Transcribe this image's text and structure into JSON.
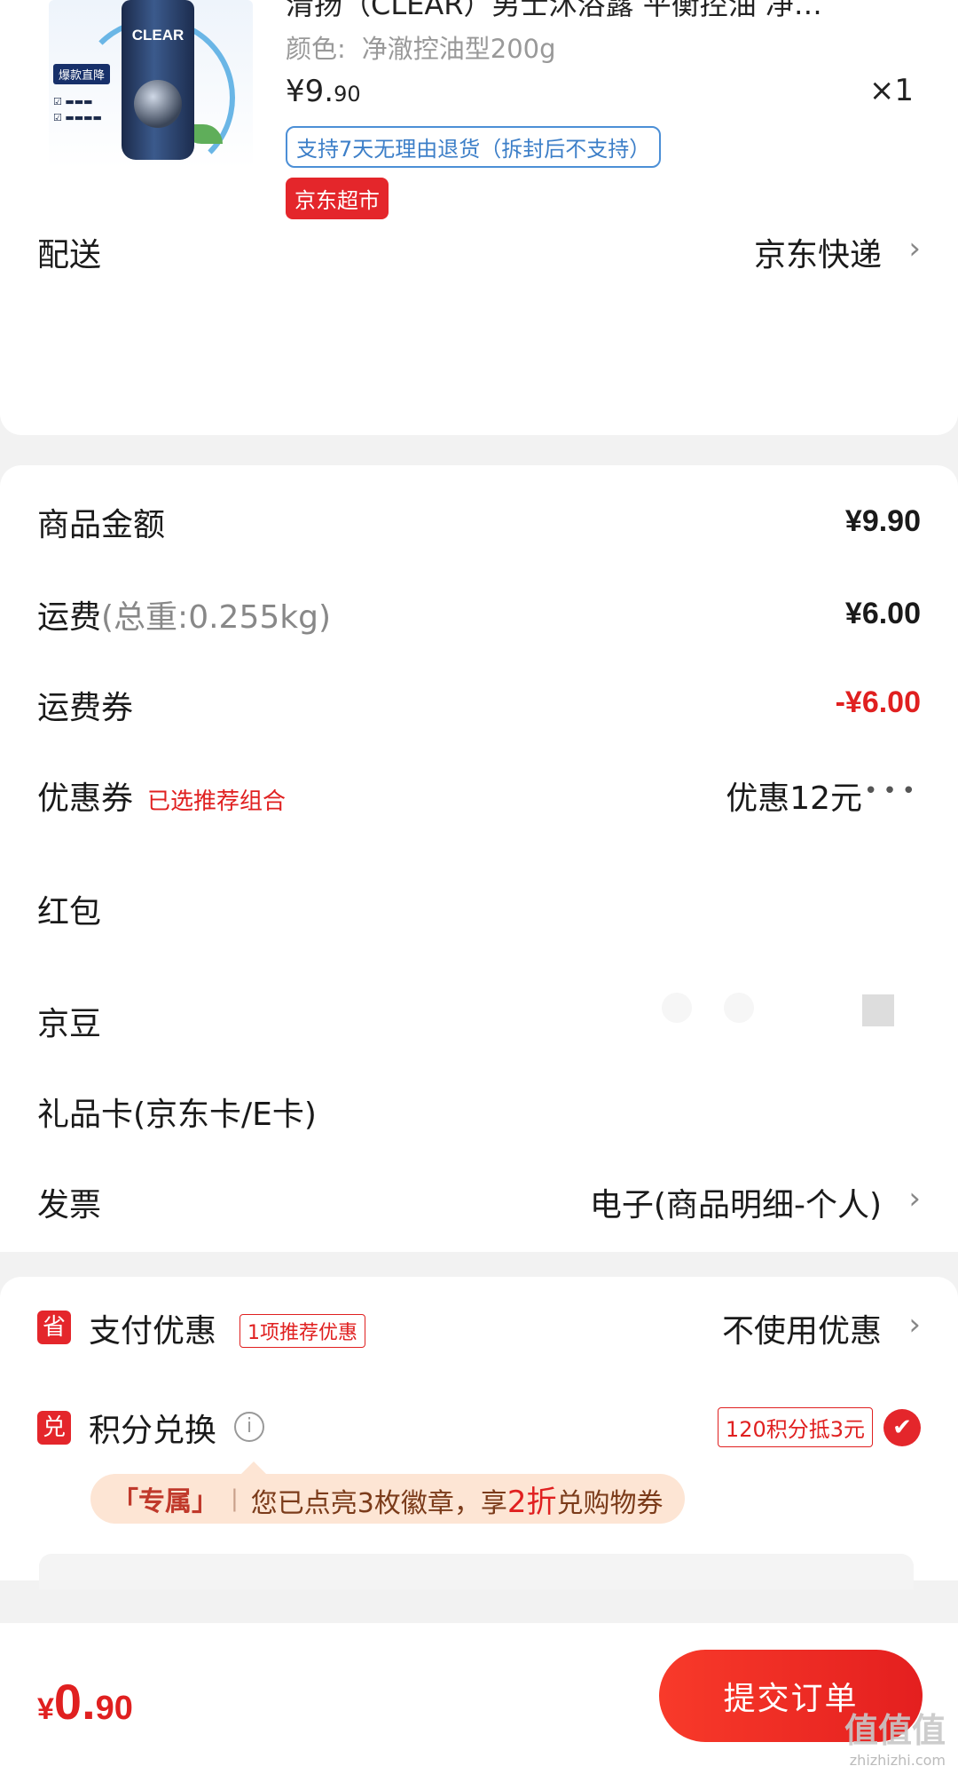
{
  "product": {
    "title": "清扬（CLEAR）男士沐浴露 平衡控油 净…",
    "variant_label": "颜色:",
    "variant_value": "净澈控油型200g",
    "price_int": "¥9.",
    "price_dec": "90",
    "quantity": "×1",
    "return_policy": "支持7天无理由退货（拆封后不支持）",
    "store_tag": "京东超市",
    "image": {
      "brand_logo": "CLEAR",
      "badge": "爆款直降"
    }
  },
  "delivery": {
    "label": "配送",
    "value": "京东快递"
  },
  "summary": {
    "goods_amount_label": "商品金额",
    "goods_amount": "¥9.90",
    "shipping_label": "运费",
    "shipping_weight": "(总重:0.255kg)",
    "shipping_amount": "¥6.00",
    "shipping_coupon_label": "运费券",
    "shipping_coupon_amount": "-¥6.00",
    "coupon_label": "优惠券",
    "coupon_tag": "已选推荐组合",
    "coupon_value": "优惠12元",
    "coupon_more": "•••",
    "red_packet_label": "红包",
    "jd_bean_label": "京豆",
    "gift_card_label": "礼品卡(京东卡/E卡)",
    "invoice_label": "发票",
    "invoice_value": "电子(商品明细-个人)"
  },
  "payment_discount": {
    "icon_text": "省",
    "label": "支付优惠",
    "tag": "1项推荐优惠",
    "value": "不使用优惠"
  },
  "points": {
    "icon_text": "兑",
    "label": "积分兑换",
    "info_icon": "i",
    "tag": "120积分抵3元",
    "checked": true
  },
  "exclusive": {
    "tag": "「专属」",
    "text_before": "您已点亮3枚徽章，享",
    "highlight": "2折",
    "text_after": "兑购物券"
  },
  "footer": {
    "currency": "¥",
    "total_int": "0.",
    "total_dec": "90",
    "submit_label": "提交订单"
  },
  "watermark": {
    "big": "值值值",
    "small": "zhizhizhi.com"
  },
  "colors": {
    "accent_red": "#e4262b",
    "link_blue": "#3d7fc8",
    "background": "#f2f2f2"
  }
}
